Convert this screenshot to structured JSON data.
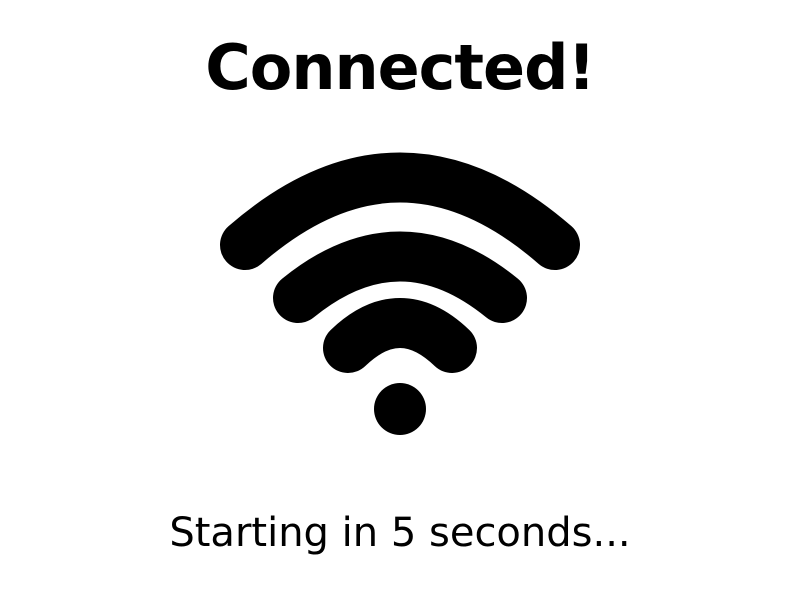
{
  "screen": {
    "title": "Connected!",
    "status_text": "Starting in 5 seconds...",
    "icon": "wifi-icon"
  },
  "colors": {
    "background": "#ffffff",
    "foreground": "#000000"
  }
}
